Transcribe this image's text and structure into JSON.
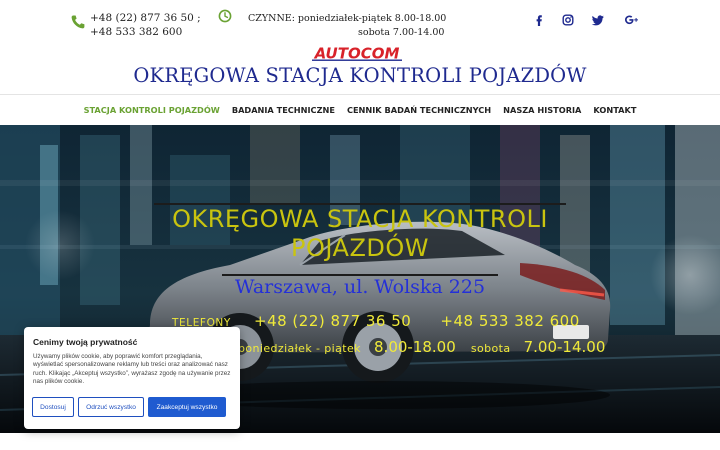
{
  "colors": {
    "accent_green": "#6aa233",
    "title_blue": "#1f2a8f",
    "logo_red": "#d8222a",
    "hero_yellow": "#f0ea3a",
    "hero_blue": "#2430d8",
    "cookie_button_blue": "#1f5bd0"
  },
  "header": {
    "phone_icon": "phone-icon",
    "phones": [
      "+48 (22) 877 36 50 ;",
      "+48 533 382 600"
    ],
    "clock_icon": "clock-icon",
    "hours_line1": "CZYNNE: poniedziałek-piątek  8.00-18.00",
    "hours_line2": "sobota  7.00-14.00",
    "social_icons": [
      "facebook-icon",
      "instagram-icon",
      "twitter-icon",
      "google-plus-icon"
    ],
    "logo_text": "AUTOCOM",
    "site_title": "OKRĘGOWA STACJA KONTROLI POJAZDÓW"
  },
  "nav": {
    "items": [
      {
        "label": "STACJA KONTROLI POJAZDÓW",
        "active": true
      },
      {
        "label": "BADANIA TECHNICZNE",
        "active": false
      },
      {
        "label": "CENNIK BADAŃ TECHNICZNYCH",
        "active": false
      },
      {
        "label": "NASZA HISTORIA",
        "active": false
      },
      {
        "label": "KONTAKT",
        "active": false
      }
    ]
  },
  "hero": {
    "title_line1": "OKRĘGOWA STACJA KONTROLI",
    "title_line2": "POJAZDÓW",
    "address": "Warszawa, ul. Wolska 225",
    "phones_label": "telefony",
    "phone1": "+48 (22) 877 36 50",
    "phone2": "+48 533 382 600",
    "weekday_label": "poniedziałek - piątek",
    "weekday_hours": "8.00-18.00",
    "saturday_label": "sobota",
    "saturday_hours": "7.00-14.00"
  },
  "cookie_banner": {
    "title": "Cenimy twoją prywatność",
    "text": "Używamy plików cookie, aby poprawić komfort przeglądania, wyświetlać spersonalizowane reklamy lub treści oraz analizować nasz ruch. Klikając „Akceptuj wszystko”, wyrażasz zgodę na używanie przez nas plików cookie.",
    "buttons": {
      "customize": "Dostosuj",
      "reject": "Odrzuć wszystko",
      "accept": "Zaakceptuj wszystko"
    }
  }
}
